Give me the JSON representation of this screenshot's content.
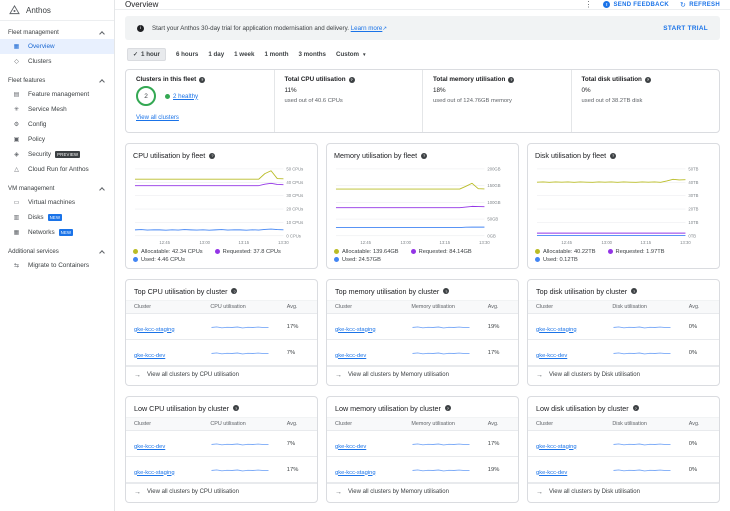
{
  "ui": {
    "help_glyph": "?",
    "check_glyph": "✓",
    "dropdown_glyph": "▼",
    "more_glyph": "⋮",
    "refresh_glyph": "↻",
    "external_glyph": "↗",
    "info_glyph": "i",
    "feedback_glyph": "!",
    "arrow_glyph": "→",
    "link_color": "#1a73e8",
    "healthy_color": "#34a853"
  },
  "sidebar": {
    "app_name": "Anthos",
    "sections": [
      {
        "label": "Fleet management",
        "items": [
          {
            "label": "Overview",
            "icon": "overview-icon",
            "glyph": "▦",
            "selected": true
          },
          {
            "label": "Clusters",
            "icon": "clusters-icon",
            "glyph": "◇"
          }
        ]
      },
      {
        "label": "Fleet features",
        "items": [
          {
            "label": "Feature management",
            "icon": "feature-management-icon",
            "glyph": "▤"
          },
          {
            "label": "Service Mesh",
            "icon": "service-mesh-icon",
            "glyph": "✳"
          },
          {
            "label": "Config",
            "icon": "config-icon",
            "glyph": "⚙"
          },
          {
            "label": "Policy",
            "icon": "policy-icon",
            "glyph": "▣"
          },
          {
            "label": "Security",
            "icon": "security-icon",
            "glyph": "◈",
            "badge": "PREVIEW"
          },
          {
            "label": "Cloud Run for Anthos",
            "icon": "cloud-run-icon",
            "glyph": "△"
          }
        ]
      },
      {
        "label": "VM management",
        "items": [
          {
            "label": "Virtual machines",
            "icon": "virtual-machines-icon",
            "glyph": "▭"
          },
          {
            "label": "Disks",
            "icon": "disks-icon",
            "glyph": "▥",
            "badge": "NEW"
          },
          {
            "label": "Networks",
            "icon": "networks-icon",
            "glyph": "▦",
            "badge": "NEW"
          }
        ]
      },
      {
        "label": "Additional services",
        "items": [
          {
            "label": "Migrate to Containers",
            "icon": "migrate-to-containers-icon",
            "glyph": "⇆"
          }
        ]
      }
    ]
  },
  "topbar": {
    "title": "Overview",
    "send_feedback": "SEND FEEDBACK",
    "refresh": "REFRESH"
  },
  "banner": {
    "text": "Start your Anthos 30-day trial for application modernisation and delivery.",
    "link": "Learn more",
    "action": "START TRIAL"
  },
  "time_filter": {
    "selected": "1 hour",
    "options": [
      "1 hour",
      "6 hours",
      "1 day",
      "1 week",
      "1 month",
      "3 months"
    ],
    "custom": "Custom"
  },
  "stats": {
    "clusters": {
      "label": "Clusters in this fleet",
      "count": "2",
      "healthy_link": "2 healthy",
      "view_all": "View all clusters"
    },
    "cpu": {
      "label": "Total CPU utilisation",
      "value": "11%",
      "sub": "used out of 40.6 CPUs"
    },
    "memory": {
      "label": "Total memory utilisation",
      "value": "18%",
      "sub": "used out of 124.76GB memory"
    },
    "disk": {
      "label": "Total disk utilisation",
      "value": "0%",
      "sub": "used out of 38.2TB disk"
    }
  },
  "chart_data": [
    {
      "type": "line",
      "title": "CPU utilisation by fleet",
      "x_ticks": [
        "12:45",
        "13:00",
        "13:15",
        "13:30"
      ],
      "y_ticks": [
        "0 CPUs",
        "10 CPUs",
        "20 CPUs",
        "30 CPUs",
        "40 CPUs",
        "50 CPUs"
      ],
      "ylim": [
        0,
        50
      ],
      "legend_position": "bottom",
      "series": [
        {
          "name": "Allocatable",
          "value_label": "Allocatable: 42.34 CPUs",
          "color": "#b9bc26",
          "values": [
            42.3,
            42.3,
            42.3,
            42.3,
            42.3,
            42.3,
            42.3,
            42.3,
            42.3,
            42.3,
            42.3,
            42.3,
            42.3,
            42.3,
            42.3,
            42.3,
            42.3,
            42.3,
            42.3,
            42.3,
            42.3,
            46.5,
            48.6,
            42.8,
            42.6
          ]
        },
        {
          "name": "Requested",
          "value_label": "Requested: 37.8 CPUs",
          "color": "#9334e6",
          "values": [
            37.5,
            37.5,
            37.5,
            37.5,
            37.5,
            37.5,
            37.5,
            37.5,
            37.5,
            37.5,
            37.5,
            37.5,
            37.5,
            37.5,
            37.5,
            37.5,
            37.5,
            37.5,
            37.5,
            37.5,
            37.5,
            38.6,
            39.2,
            38.4,
            38.2
          ]
        },
        {
          "name": "Used",
          "value_label": "Used: 4.46 CPUs",
          "color": "#4285f4",
          "values": [
            4.4,
            4.6,
            4.3,
            4.5,
            4.4,
            4.2,
            4.5,
            4.3,
            4.6,
            4.4,
            4.3,
            4.5,
            4.2,
            4.4,
            4.6,
            4.3,
            4.5,
            4.4,
            4.2,
            4.5,
            4.3,
            4.8,
            5.0,
            4.6,
            4.5
          ]
        }
      ]
    },
    {
      "type": "line",
      "title": "Memory utilisation by fleet",
      "x_ticks": [
        "12:45",
        "13:00",
        "13:15",
        "13:30"
      ],
      "y_ticks": [
        "0GB",
        "50GB",
        "100GB",
        "150GB",
        "200GB"
      ],
      "ylim": [
        0,
        200
      ],
      "legend_position": "bottom",
      "series": [
        {
          "name": "Allocatable",
          "value_label": "Allocatable: 139.64GB",
          "color": "#b9bc26",
          "values": [
            139.6,
            139.6,
            139.6,
            139.6,
            139.6,
            139.6,
            139.6,
            139.6,
            139.6,
            139.6,
            139.6,
            139.6,
            139.6,
            139.6,
            139.6,
            139.6,
            139.6,
            139.6,
            139.6,
            139.6,
            139.6,
            148,
            157,
            141,
            140
          ]
        },
        {
          "name": "Requested",
          "value_label": "Requested: 84.14GB",
          "color": "#9334e6",
          "values": [
            84.1,
            84.1,
            84.1,
            84.1,
            84.1,
            84.1,
            84.1,
            84.1,
            84.1,
            84.1,
            84.1,
            84.1,
            84.1,
            84.1,
            84.1,
            84.1,
            84.1,
            84.1,
            84.1,
            84.1,
            84.1,
            86,
            88,
            87.5,
            87
          ]
        },
        {
          "name": "Used",
          "value_label": "Used: 24.57GB",
          "color": "#4285f4",
          "values": [
            24.6,
            24.6,
            24.6,
            24.6,
            24.6,
            24.6,
            24.6,
            24.6,
            24.6,
            24.6,
            24.6,
            24.6,
            24.6,
            24.6,
            24.6,
            24.6,
            24.6,
            24.6,
            24.6,
            24.6,
            24.6,
            25.5,
            26,
            26,
            25.8
          ]
        }
      ]
    },
    {
      "type": "line",
      "title": "Disk utilisation by fleet",
      "x_ticks": [
        "12:45",
        "13:00",
        "13:15",
        "13:30"
      ],
      "y_ticks": [
        "0TB",
        "10TB",
        "20TB",
        "30TB",
        "40TB",
        "50TB"
      ],
      "ylim": [
        0,
        50
      ],
      "legend_position": "bottom",
      "series": [
        {
          "name": "Allocatable",
          "value_label": "Allocatable: 40.22TB",
          "color": "#b9bc26",
          "values": [
            40.1,
            40.2,
            40.0,
            40.2,
            40.1,
            40.3,
            40.0,
            40.2,
            40.1,
            40.0,
            40.2,
            40.1,
            40.3,
            40.0,
            40.2,
            40.1,
            40.0,
            40.2,
            40.1,
            40.3,
            40.0,
            41.0,
            42.2,
            41.8,
            41.9
          ]
        },
        {
          "name": "Requested",
          "value_label": "Requested: 1.97TB",
          "color": "#9334e6",
          "values": [
            1.97,
            1.97,
            1.97,
            1.97,
            1.97,
            1.97,
            1.97,
            1.97,
            1.97,
            1.97,
            1.97,
            1.97,
            1.97,
            1.97,
            1.97,
            1.97,
            1.97,
            1.97,
            1.97,
            1.97,
            1.97,
            1.97,
            1.97,
            1.97,
            1.97
          ]
        },
        {
          "name": "Used",
          "value_label": "Used: 0.12TB",
          "color": "#4285f4",
          "values": [
            0.12,
            0.12,
            0.12,
            0.12,
            0.12,
            0.12,
            0.12,
            0.12,
            0.12,
            0.12,
            0.12,
            0.12,
            0.12,
            0.12,
            0.12,
            0.12,
            0.12,
            0.12,
            0.12,
            0.12,
            0.12,
            0.12,
            0.12,
            0.12,
            0.12
          ]
        }
      ]
    }
  ],
  "tables": {
    "sparkline": [
      0.5,
      0.62,
      0.45,
      0.55,
      0.5,
      0.6,
      0.42,
      0.55,
      0.5,
      0.58,
      0.48,
      0.52
    ],
    "top_cpu": {
      "title": "Top CPU utilisation by cluster",
      "headers": [
        "Cluster",
        "CPU utilisation",
        "Avg."
      ],
      "rows": [
        {
          "cluster": "gke-kcc-staging",
          "avg": "17%"
        },
        {
          "cluster": "gke-kcc-dev",
          "avg": "7%"
        }
      ],
      "footer": "View all clusters by CPU utilisation"
    },
    "top_memory": {
      "title": "Top memory utilisation by cluster",
      "headers": [
        "Cluster",
        "Memory utilisation",
        "Avg."
      ],
      "rows": [
        {
          "cluster": "gke-kcc-staging",
          "avg": "19%"
        },
        {
          "cluster": "gke-kcc-dev",
          "avg": "17%"
        }
      ],
      "footer": "View all clusters by Memory utilisation"
    },
    "top_disk": {
      "title": "Top disk utilisation by cluster",
      "headers": [
        "Cluster",
        "Disk utilisation",
        "Avg."
      ],
      "rows": [
        {
          "cluster": "gke-kcc-staging",
          "avg": "0%"
        },
        {
          "cluster": "gke-kcc-dev",
          "avg": "0%"
        }
      ],
      "footer": "View all clusters by Disk utilisation"
    },
    "low_cpu": {
      "title": "Low CPU utilisation by cluster",
      "headers": [
        "Cluster",
        "CPU utilisation",
        "Avg."
      ],
      "rows": [
        {
          "cluster": "gke-kcc-dev",
          "avg": "7%"
        },
        {
          "cluster": "gke-kcc-staging",
          "avg": "17%"
        }
      ],
      "footer": "View all clusters by CPU utilisation"
    },
    "low_memory": {
      "title": "Low memory utilisation by cluster",
      "headers": [
        "Cluster",
        "Memory utilisation",
        "Avg."
      ],
      "rows": [
        {
          "cluster": "gke-kcc-dev",
          "avg": "17%"
        },
        {
          "cluster": "gke-kcc-staging",
          "avg": "19%"
        }
      ],
      "footer": "View all clusters by Memory utilisation"
    },
    "low_disk": {
      "title": "Low disk utilisation by cluster",
      "headers": [
        "Cluster",
        "Disk utilisation",
        "Avg."
      ],
      "rows": [
        {
          "cluster": "gke-kcc-staging",
          "avg": "0%"
        },
        {
          "cluster": "gke-kcc-dev",
          "avg": "0%"
        }
      ],
      "footer": "View all clusters by Disk utilisation"
    }
  }
}
